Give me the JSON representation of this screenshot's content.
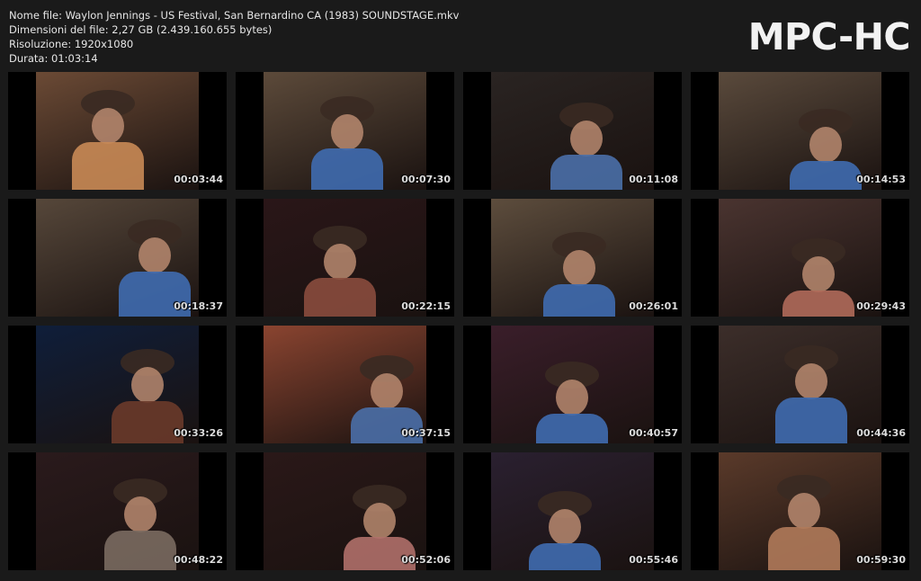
{
  "header": {
    "file_name": "Nome file: Waylon Jennings - US Festival, San Bernardino CA (1983) SOUNDSTAGE.mkv",
    "file_size": "Dimensioni del file: 2,27 GB (2.439.160.655 bytes)",
    "resolution": "Risoluzione: 1920x1080",
    "duration": "Durata: 01:03:14"
  },
  "logo": "MPC-HC",
  "thumbnails": [
    {
      "time": "00:03:44",
      "bg": "#6b4a35",
      "accent": "#c98a55"
    },
    {
      "time": "00:07:30",
      "bg": "#5c4a3a",
      "accent": "#3f6bb0"
    },
    {
      "time": "00:11:08",
      "bg": "#2a2422",
      "accent": "#4a6fa8"
    },
    {
      "time": "00:14:53",
      "bg": "#5a4a3c",
      "accent": "#3f6bb0"
    },
    {
      "time": "00:18:37",
      "bg": "#56473a",
      "accent": "#3f6bb0"
    },
    {
      "time": "00:22:15",
      "bg": "#2a1618",
      "accent": "#8a4d3e"
    },
    {
      "time": "00:26:01",
      "bg": "#5d4d3d",
      "accent": "#3f6bb0"
    },
    {
      "time": "00:29:43",
      "bg": "#4a3430",
      "accent": "#b06a5a"
    },
    {
      "time": "00:33:26",
      "bg": "#0f1e3a",
      "accent": "#6a3a2a"
    },
    {
      "time": "00:37:15",
      "bg": "#8a4430",
      "accent": "#4a6fa8"
    },
    {
      "time": "00:40:57",
      "bg": "#3a1e2a",
      "accent": "#3f6bb0"
    },
    {
      "time": "00:44:36",
      "bg": "#3c2e2a",
      "accent": "#3f6bb0"
    },
    {
      "time": "00:48:22",
      "bg": "#2a1a1c",
      "accent": "#7a6a60"
    },
    {
      "time": "00:52:06",
      "bg": "#2a1818",
      "accent": "#b0706a"
    },
    {
      "time": "00:55:46",
      "bg": "#2a2030",
      "accent": "#3f6bb0"
    },
    {
      "time": "00:59:30",
      "bg": "#5a3a2a",
      "accent": "#b07a5a"
    }
  ]
}
